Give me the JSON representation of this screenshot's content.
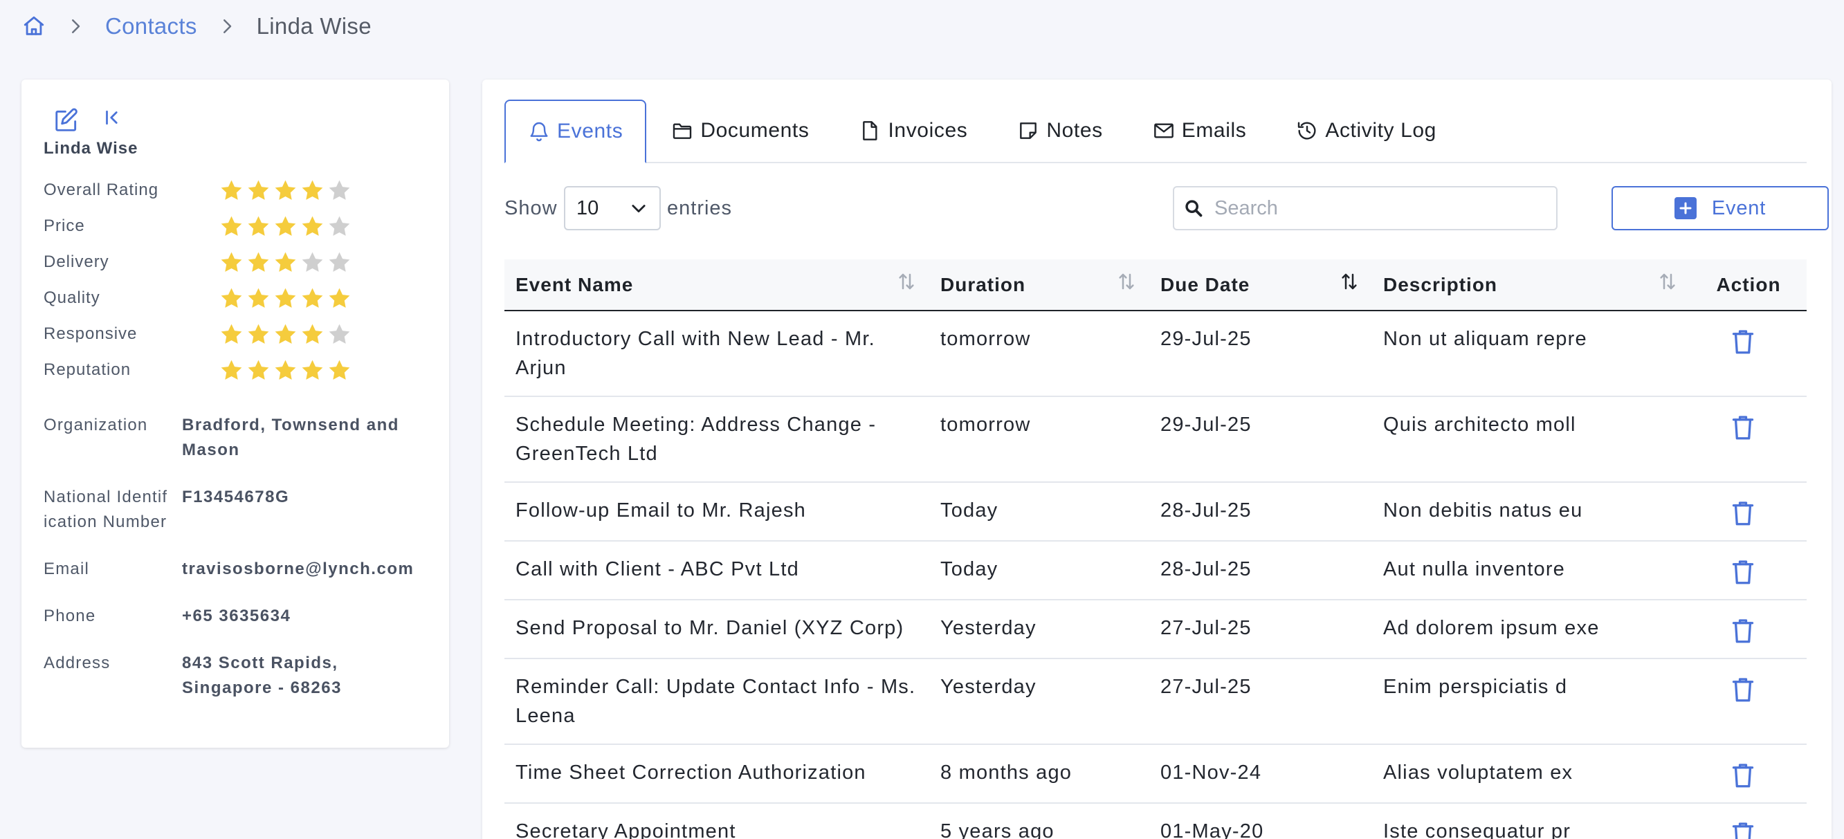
{
  "breadcrumb": {
    "parent": "Contacts",
    "current": "Linda Wise"
  },
  "profile": {
    "name": "Linda Wise",
    "ratings": [
      {
        "label": "Overall Rating",
        "stars": 4
      },
      {
        "label": "Price",
        "stars": 4
      },
      {
        "label": "Delivery",
        "stars": 3
      },
      {
        "label": "Quality",
        "stars": 5
      },
      {
        "label": "Responsive",
        "stars": 4
      },
      {
        "label": "Reputation",
        "stars": 5
      }
    ],
    "details": [
      {
        "label": "Organization",
        "value": "Bradford, Townsend and Mason"
      },
      {
        "label": "National Identification Number",
        "value": "F13454678G"
      },
      {
        "label": "Email",
        "value": "travisosborne@lynch.com"
      },
      {
        "label": "Phone",
        "value": "+65 3635634"
      },
      {
        "label": "Address",
        "value": "843 Scott Rapids, Singapore - 68263"
      }
    ]
  },
  "tabs": [
    {
      "label": "Events",
      "icon": "bell-icon",
      "active": true
    },
    {
      "label": "Documents",
      "icon": "folder-icon",
      "active": false
    },
    {
      "label": "Invoices",
      "icon": "file-icon",
      "active": false
    },
    {
      "label": "Notes",
      "icon": "note-icon",
      "active": false
    },
    {
      "label": "Emails",
      "icon": "mail-icon",
      "active": false
    },
    {
      "label": "Activity Log",
      "icon": "history-icon",
      "active": false
    }
  ],
  "controls": {
    "show_label": "Show",
    "page_size": "10",
    "entries_label": "entries",
    "search_placeholder": "Search",
    "add_label": "Event"
  },
  "table": {
    "headers": [
      "Event Name",
      "Duration",
      "Due Date",
      "Description",
      "Action"
    ],
    "rows": [
      [
        "Introductory Call with New Lead - Mr. Arjun",
        "tomorrow",
        "29-Jul-25",
        "Non ut aliquam repre"
      ],
      [
        "Schedule Meeting: Address Change - GreenTech Ltd",
        "tomorrow",
        "29-Jul-25",
        "Quis architecto moll"
      ],
      [
        "Follow-up Email to Mr. Rajesh",
        "Today",
        "28-Jul-25",
        "Non debitis natus eu"
      ],
      [
        "Call with Client - ABC Pvt Ltd",
        "Today",
        "28-Jul-25",
        "Aut nulla inventore"
      ],
      [
        "Send Proposal to Mr. Daniel (XYZ Corp)",
        "Yesterday",
        "27-Jul-25",
        "Ad dolorem ipsum exe"
      ],
      [
        "Reminder Call: Update Contact Info - Ms. Leena",
        "Yesterday",
        "27-Jul-25",
        "Enim perspiciatis d"
      ],
      [
        "Time Sheet Correction Authorization",
        "8 months ago",
        "01-Nov-24",
        "Alias voluptatem ex"
      ],
      [
        "Secretary Appointment",
        "5 years ago",
        "01-May-20",
        "Iste consequatur pr"
      ]
    ]
  },
  "colors": {
    "accent": "#4a72d8",
    "star_on": "#f5cc3d",
    "star_off": "#cfcfcf",
    "background": "#f5f6fb"
  }
}
